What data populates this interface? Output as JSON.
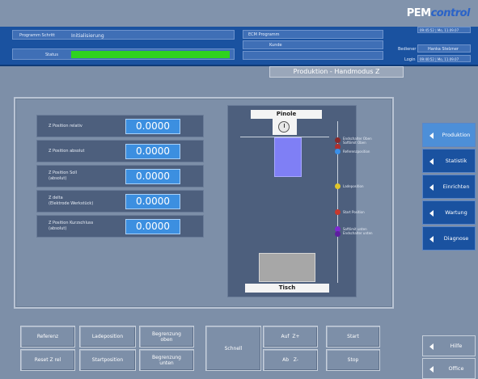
{
  "brand": {
    "pem": "PEM",
    "control": "control"
  },
  "header": {
    "programm_schritt_label": "Programm Schritt",
    "programm_schritt_value": "Initialisierung",
    "status_label": "Status",
    "status_color": "#2fd21f",
    "ecm_programm_label": "ECM Programm",
    "kunde_label": "Kunde",
    "top_right_1": "09:45:52 | Mo, 11.09.07",
    "bediener_label": "Bediener",
    "bediener_value": "Hanka Stelzner",
    "login_label": "Login",
    "login_value": "09:40:52 | Mo, 11.09.07"
  },
  "page_title": "Produktion - Handmodus Z",
  "fields": [
    {
      "label": "Z Position relativ",
      "value": "0.0000"
    },
    {
      "label": "Z Position absolut",
      "value": "0.0000"
    },
    {
      "label": "Z Position Soll\n(absolut)",
      "value": "0.0000"
    },
    {
      "label": "Z delta\n(Elektrode Werkstück)",
      "value": "0.0000"
    },
    {
      "label": "Z Position Kurzschluss\n(absolut)",
      "value": "0.0000"
    }
  ],
  "diagram": {
    "pinole": "Pinole",
    "tisch": "Tisch",
    "markers": [
      {
        "label": "Endschalter Oben\nSoftlimit Oben",
        "color": "#8b2a2a"
      },
      {
        "label": "Referenzposition",
        "color": "#3a8fe8"
      },
      {
        "label": "Ladeposition",
        "color": "#e0c52a"
      },
      {
        "label": "Start Position",
        "color": "#c7382e"
      },
      {
        "label": "Softlimit unten\nEndschalter unten",
        "color": "#7d2ad0"
      }
    ]
  },
  "side_nav": [
    {
      "label": "Produktion",
      "active": true
    },
    {
      "label": "Statistik",
      "active": false
    },
    {
      "label": "Einrichten",
      "active": false
    },
    {
      "label": "Wartung",
      "active": false
    },
    {
      "label": "Diagnose",
      "active": false
    }
  ],
  "bottom_buttons": {
    "referenz": "Referenz",
    "ladeposition": "Ladeposition",
    "begrenzung_oben": "Begrenzung\noben",
    "reset_z_rel": "Reset Z rel",
    "startposition": "Startposition",
    "begrenzung_unten": "Begrenzung\nunten",
    "schnell": "Schnell",
    "auf_z_plus": "Auf  Z+",
    "ab_z_minus": "Ab   Z-",
    "start": "Start",
    "stop": "Stop"
  },
  "bottom_nav": {
    "hilfe": "Hilfe",
    "office": "Office"
  }
}
